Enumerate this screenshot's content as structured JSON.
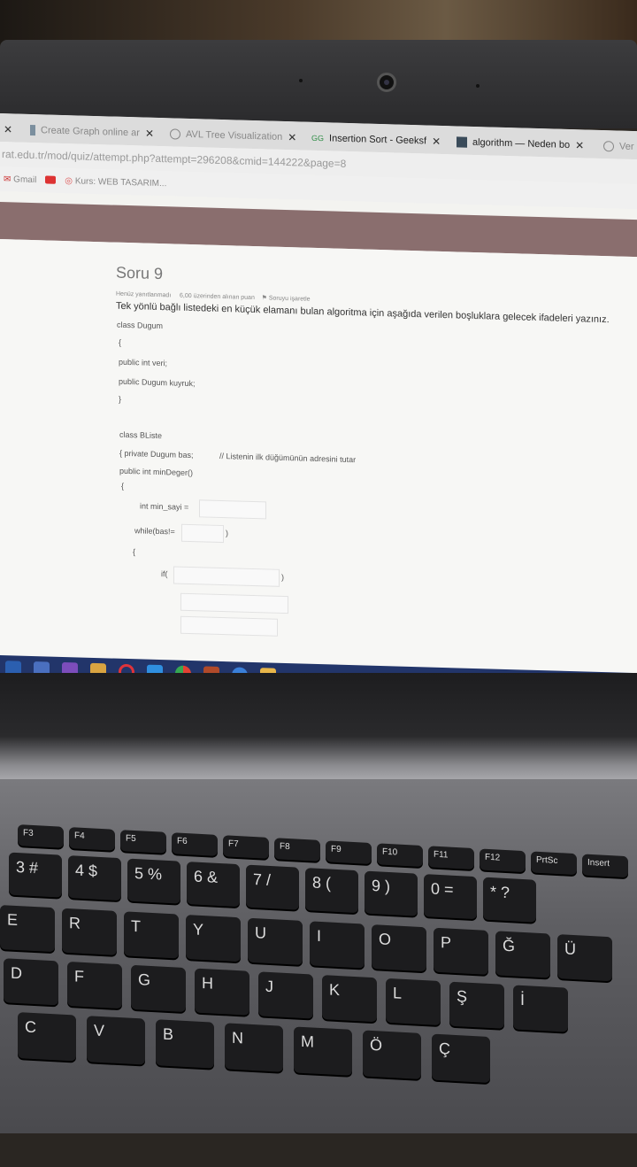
{
  "tabs": [
    {
      "label": "Create Graph online ar",
      "icon": "graph-site-icon",
      "active": false
    },
    {
      "label": "AVL Tree Visualization",
      "icon": "globe-icon",
      "active": false
    },
    {
      "label": "Insertion Sort - Geeksf",
      "icon": "geeks-icon",
      "active": true
    },
    {
      "label": "algorithm — Neden bo",
      "icon": "stackexchange-icon",
      "active": false
    },
    {
      "label": "Ver",
      "icon": "globe-icon",
      "active": false
    }
  ],
  "address": "rat.edu.tr/mod/quiz/attempt.php?attempt=296208&cmid=144222&page=8",
  "bookmarks": [
    {
      "label": "Gmail",
      "icon": "gmail-icon"
    },
    {
      "label": "",
      "icon": "youtube-icon"
    },
    {
      "label": "Kurs: WEB TASARIM...",
      "icon": "course-icon"
    }
  ],
  "question": {
    "title": "Soru 9",
    "status": "Henüz yanıtlanmadı",
    "points": "6,00 üzerinden alınan puan",
    "flag": "Soruyu işaretle",
    "text": "Tek yönlü bağlı listedeki en küçük elamanı bulan algoritma için aşağıda verilen boşluklara gelecek ifadeleri yazınız."
  },
  "code_lines": [
    "class Dugum",
    "{",
    "public int veri;",
    "public Dugum kuyruk;",
    "}",
    "class BListe",
    "{ private Dugum bas;",
    "// Listenin ilk düğümünün adresini tutar",
    "public int minDeger()",
    "{",
    "int min_sayi =",
    "while(bas!=",
    ")",
    "{",
    "if(",
    ")"
  ],
  "taskbar_icons": [
    "start-icon",
    "task-view-icon",
    "visual-studio-icon",
    "paint-icon",
    "opera-icon",
    "vscode-icon",
    "chrome-icon",
    "app-icon",
    "edge-icon",
    "file-explorer-icon"
  ],
  "keyboard": {
    "fn_row": [
      "F3",
      "F4",
      "F5",
      "F6",
      "F7",
      "F8",
      "F9",
      "F10",
      "F11",
      "F12",
      "PrtSc",
      "Insert"
    ],
    "num_row": [
      "3 #",
      "4 $",
      "5 %",
      "6 &",
      "7 /",
      "8 (",
      "9 )",
      "0 =",
      "* ?"
    ],
    "row_q": [
      "E",
      "R",
      "T",
      "Y",
      "U",
      "I",
      "O",
      "P",
      "Ğ",
      "Ü"
    ],
    "row_a": [
      "D",
      "F",
      "G",
      "H",
      "J",
      "K",
      "L",
      "Ş",
      "İ"
    ],
    "row_z": [
      "C",
      "V",
      "B",
      "N",
      "M",
      "Ö",
      "Ç"
    ]
  },
  "colors": {
    "header_band": "#8a6e6e",
    "taskbar": "#22356a"
  }
}
